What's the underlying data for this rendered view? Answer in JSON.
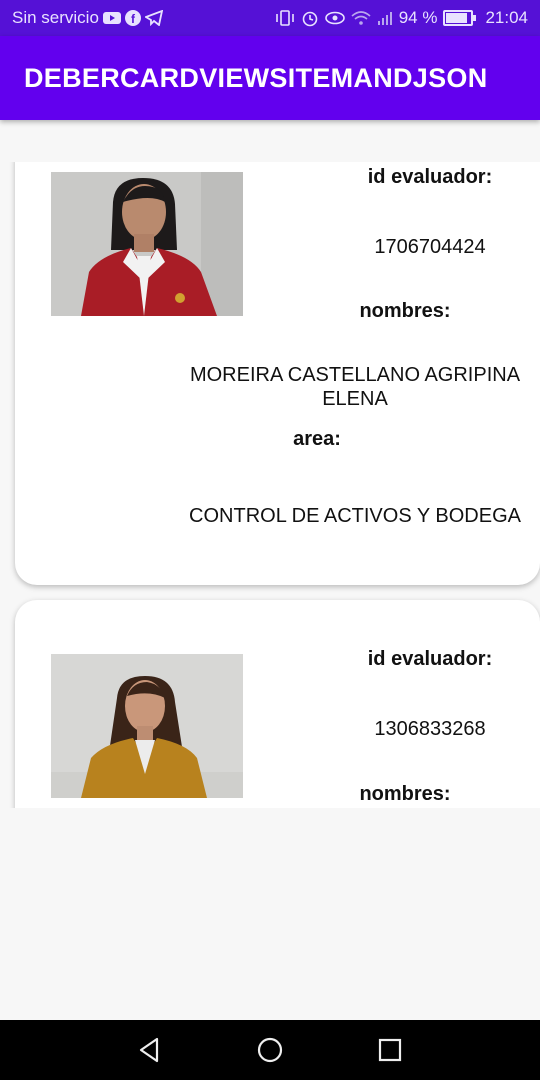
{
  "status_bar": {
    "carrier": "Sin servicio",
    "battery_text": "94 %",
    "battery_level": 0.94,
    "time": "21:04",
    "icons": [
      "youtube-icon",
      "facebook-icon",
      "telegram-icon",
      "vibrate-icon",
      "alarm-icon",
      "eye-icon",
      "wifi-icon",
      "signal-icon",
      "battery-icon"
    ]
  },
  "app_bar": {
    "title": "DEBERCARDVIEWSITEMANDJSON"
  },
  "cards": [
    {
      "id_label": "id evaluador:",
      "id_value": "1706704424",
      "nombres_label": "nombres:",
      "nombres_value": "MOREIRA CASTELLANO AGRIPINA ELENA",
      "area_label": "area:",
      "area_value": "CONTROL DE ACTIVOS Y BODEGA"
    },
    {
      "id_label": "id evaluador:",
      "id_value": "1306833268",
      "nombres_label": "nombres:"
    }
  ],
  "nav_bar": {
    "icons": [
      "back-icon",
      "home-icon",
      "recents-icon"
    ]
  }
}
